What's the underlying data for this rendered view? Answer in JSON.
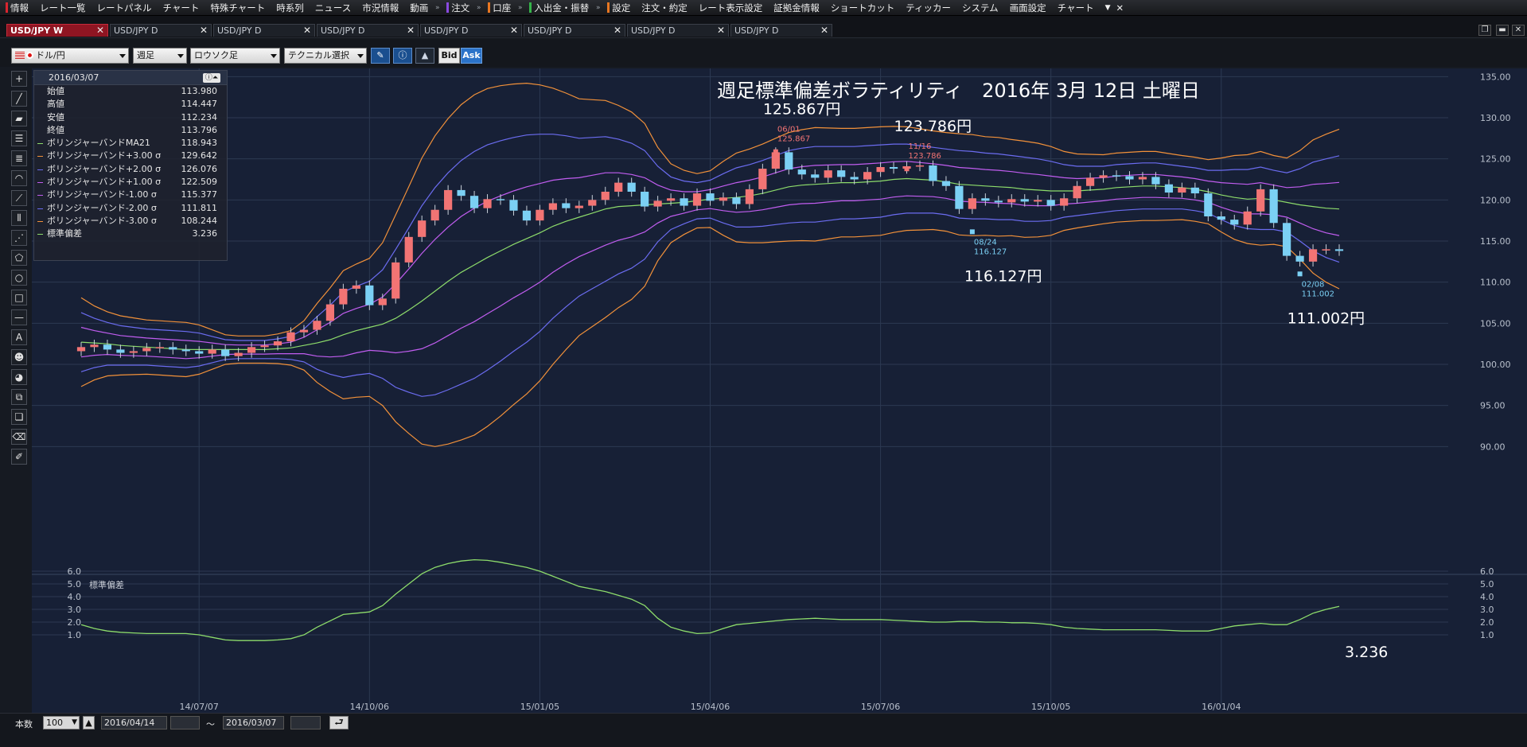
{
  "menubar": {
    "items": [
      "情報",
      "レート一覧",
      "レートパネル",
      "チャート",
      "特殊チャート",
      "時系列",
      "ニュース",
      "市況情報",
      "動画",
      "注文",
      "口座",
      "入出金・振替",
      "設定",
      "注文・約定",
      "レート表示設定",
      "証拠金情報",
      "ショートカット",
      "ティッカー",
      "システム",
      "画面設定",
      "チャート"
    ]
  },
  "tabs": [
    {
      "label": "USD/JPY W",
      "active": true
    },
    {
      "label": "USD/JPY D",
      "active": false
    },
    {
      "label": "USD/JPY D",
      "active": false
    },
    {
      "label": "USD/JPY D",
      "active": false
    },
    {
      "label": "USD/JPY D",
      "active": false
    },
    {
      "label": "USD/JPY D",
      "active": false
    },
    {
      "label": "USD/JPY D",
      "active": false
    },
    {
      "label": "USD/JPY D",
      "active": false
    }
  ],
  "toolbar": {
    "pair": "ドル/円",
    "period": "週足",
    "chart_type": "ロウソク足",
    "technical": "テクニカル選択",
    "bid": "Bid",
    "ask": "Ask"
  },
  "info_panel": {
    "date": "2016/03/07",
    "rows": [
      {
        "label": "始値",
        "value": "113.980",
        "color": ""
      },
      {
        "label": "高値",
        "value": "114.447",
        "color": ""
      },
      {
        "label": "安値",
        "value": "112.234",
        "color": ""
      },
      {
        "label": "終値",
        "value": "113.796",
        "color": ""
      },
      {
        "label": "ボリンジャーバンドMA21",
        "value": "118.943",
        "color": "#8ddc6b"
      },
      {
        "label": "ボリンジャーバンド+3.00 σ",
        "value": "129.642",
        "color": "#f2913a"
      },
      {
        "label": "ボリンジャーバンド+2.00 σ",
        "value": "126.076",
        "color": "#6b6cf0"
      },
      {
        "label": "ボリンジャーバンド+1.00 σ",
        "value": "122.509",
        "color": "#c15df0"
      },
      {
        "label": "ボリンジャーバンド-1.00 σ",
        "value": "115.377",
        "color": "#c15df0"
      },
      {
        "label": "ボリンジャーバンド-2.00 σ",
        "value": "111.811",
        "color": "#6b6cf0"
      },
      {
        "label": "ボリンジャーバンド-3.00 σ",
        "value": "108.244",
        "color": "#f2913a"
      },
      {
        "label": "標準偏差",
        "value": "3.236",
        "color": "#8ddc6b"
      }
    ]
  },
  "chart_data": [
    {
      "type": "candlestick",
      "title": "週足標準偏差ボラティリティ　2016年 3月 12日 土曜日",
      "ylim": [
        88,
        136
      ],
      "y_ticks": [
        "135.00",
        "130.00",
        "125.00",
        "120.00",
        "115.00",
        "110.00",
        "105.00",
        "100.00",
        "95.00",
        "90.00"
      ],
      "x_ticks": [
        "14/07/07",
        "14/10/06",
        "15/01/05",
        "15/04/06",
        "15/07/06",
        "15/10/05",
        "16/01/04"
      ],
      "annotations": [
        {
          "text": "125.867円",
          "marker": "06/01",
          "marker_value": "125.867"
        },
        {
          "text": "123.786円",
          "marker": "11/16",
          "marker_value": "123.786"
        },
        {
          "text": "116.127円",
          "marker": "08/24",
          "marker_value": "116.127"
        },
        {
          "text": "111.002円",
          "marker": "02/08",
          "marker_value": "111.002"
        }
      ],
      "series_colors": {
        "ma21": "#8ddc6b",
        "sigma3": "#f2913a",
        "sigma2": "#6b6cf0",
        "sigma1": "#c15df0",
        "up": "#f27474",
        "down": "#7bd0f4"
      },
      "closes": [
        102.1,
        102.4,
        101.8,
        101.4,
        101.6,
        102.0,
        102.1,
        101.8,
        101.6,
        101.3,
        101.8,
        101.0,
        101.4,
        102.1,
        102.3,
        102.8,
        103.9,
        104.2,
        105.3,
        107.3,
        109.2,
        109.6,
        107.2,
        108.0,
        112.4,
        115.5,
        117.5,
        118.8,
        121.2,
        120.5,
        119.0,
        120.1,
        120.0,
        118.7,
        117.5,
        118.8,
        119.6,
        119.0,
        119.3,
        120.0,
        121.0,
        122.1,
        121.0,
        119.2,
        119.9,
        120.2,
        119.3,
        120.8,
        119.9,
        120.3,
        119.5,
        121.3,
        123.8,
        125.8,
        123.7,
        123.1,
        122.7,
        123.6,
        122.8,
        122.5,
        123.4,
        124.0,
        123.8,
        124.1,
        124.2,
        122.3,
        121.7,
        118.9,
        120.2,
        119.9,
        119.7,
        120.1,
        119.8,
        120.0,
        119.3,
        120.2,
        121.7,
        122.7,
        123.0,
        122.9,
        122.5,
        122.8,
        121.9,
        120.9,
        121.5,
        120.8,
        118.0,
        117.6,
        117.0,
        118.6,
        121.3,
        117.2,
        113.2,
        112.5,
        114.0,
        114.0,
        113.8
      ],
      "opens": [
        101.6,
        102.1,
        102.4,
        101.8,
        101.4,
        101.6,
        102.0,
        102.1,
        101.8,
        101.6,
        101.3,
        101.8,
        101.0,
        101.4,
        102.1,
        102.3,
        102.8,
        103.9,
        104.2,
        105.3,
        107.3,
        109.2,
        109.6,
        107.2,
        108.0,
        112.4,
        115.5,
        117.5,
        118.8,
        121.2,
        120.5,
        119.0,
        120.1,
        120.0,
        118.7,
        117.5,
        118.8,
        119.6,
        119.0,
        119.3,
        120.0,
        121.0,
        122.1,
        121.0,
        119.2,
        119.9,
        120.2,
        119.3,
        120.8,
        119.9,
        120.3,
        119.5,
        121.3,
        123.8,
        125.8,
        123.7,
        123.1,
        122.7,
        123.6,
        122.8,
        122.5,
        123.4,
        124.0,
        123.8,
        124.1,
        124.2,
        122.3,
        121.7,
        118.9,
        120.2,
        119.9,
        119.7,
        120.1,
        119.8,
        120.0,
        119.3,
        120.2,
        121.7,
        122.7,
        123.0,
        122.9,
        122.5,
        122.8,
        121.9,
        120.9,
        121.5,
        120.8,
        118.0,
        117.6,
        117.0,
        118.6,
        121.3,
        117.2,
        113.2,
        112.5,
        114.0,
        114.0
      ],
      "ma21": [
        102.7,
        102.6,
        102.5,
        102.3,
        102.2,
        102.1,
        102.0,
        101.9,
        101.8,
        101.8,
        101.8,
        101.8,
        101.8,
        101.8,
        101.8,
        101.9,
        102.0,
        102.3,
        102.6,
        103.0,
        103.6,
        104.1,
        104.5,
        104.9,
        105.6,
        106.6,
        107.7,
        108.9,
        110.1,
        111.2,
        112.1,
        113.0,
        113.8,
        114.6,
        115.3,
        116.0,
        116.8,
        117.4,
        117.9,
        118.4,
        118.9,
        119.2,
        119.3,
        119.4,
        119.5,
        119.6,
        119.7,
        119.9,
        120.1,
        120.2,
        120.3,
        120.5,
        120.8,
        121.2,
        121.6,
        121.8,
        121.9,
        122.0,
        122.1,
        122.1,
        122.2,
        122.3,
        122.5,
        122.6,
        122.5,
        122.4,
        122.2,
        121.9,
        121.8,
        121.7,
        121.6,
        121.5,
        121.3,
        121.2,
        121.1,
        121.1,
        121.1,
        121.2,
        121.3,
        121.5,
        121.6,
        121.7,
        121.7,
        121.6,
        121.5,
        121.3,
        121.0,
        120.6,
        120.3,
        120.1,
        120.2,
        120.0,
        119.7,
        119.4,
        119.2,
        119.0,
        118.9
      ],
      "sd": [
        1.8,
        1.5,
        1.3,
        1.2,
        1.15,
        1.1,
        1.1,
        1.1,
        1.1,
        1.0,
        0.8,
        0.6,
        0.55,
        0.55,
        0.55,
        0.6,
        0.7,
        1.0,
        1.6,
        2.1,
        2.6,
        2.7,
        2.8,
        3.3,
        4.2,
        5.0,
        5.8,
        6.3,
        6.6,
        6.8,
        6.9,
        6.85,
        6.7,
        6.5,
        6.3,
        6.0,
        5.6,
        5.2,
        4.8,
        4.6,
        4.4,
        4.1,
        3.8,
        3.3,
        2.3,
        1.6,
        1.3,
        1.1,
        1.15,
        1.5,
        1.8,
        1.9,
        2.0,
        2.1,
        2.2,
        2.25,
        2.3,
        2.25,
        2.2,
        2.2,
        2.2,
        2.2,
        2.15,
        2.1,
        2.05,
        2.0,
        2.0,
        2.05,
        2.05,
        2.0,
        2.0,
        1.95,
        1.95,
        1.9,
        1.8,
        1.6,
        1.5,
        1.45,
        1.4,
        1.4,
        1.4,
        1.4,
        1.4,
        1.35,
        1.3,
        1.3,
        1.3,
        1.5,
        1.7,
        1.8,
        1.9,
        1.8,
        1.8,
        2.2,
        2.7,
        3.0,
        3.236
      ]
    },
    {
      "type": "line",
      "title": "標準偏差",
      "ylim": [
        0,
        7
      ],
      "y_ticks": [
        "6.0",
        "5.0",
        "4.0",
        "3.0",
        "2.0",
        "1.0"
      ],
      "last_value_label": "3.236"
    }
  ],
  "bottom": {
    "count_label": "本数",
    "count_value": "100",
    "from_date": "2016/04/14",
    "range_sep": "～",
    "to_date": "2016/03/07"
  }
}
